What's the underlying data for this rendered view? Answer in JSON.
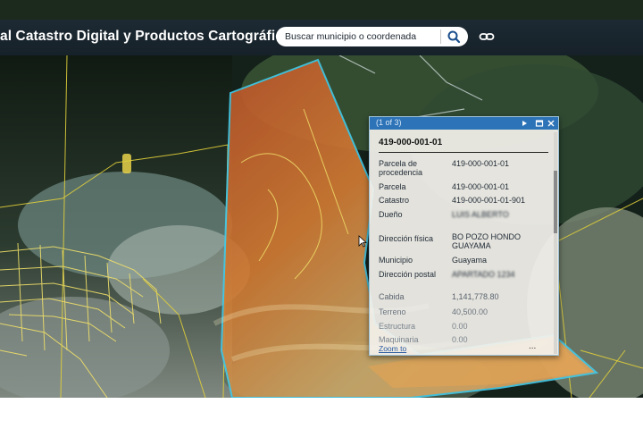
{
  "header": {
    "title": "al Catastro Digital y Productos Cartográficos",
    "search_placeholder": "Buscar municipio o coordenada"
  },
  "icons": {
    "search": "search-icon",
    "link": "link-icon",
    "next": "next-arrow-icon",
    "maximize": "maximize-icon",
    "close": "close-icon",
    "cursor": "mouse-cursor-icon"
  },
  "popup": {
    "counter": "(1 of 3)",
    "heading": "419-000-001-01",
    "fields": [
      {
        "label": "Parcela de",
        "label2": "procedencia",
        "value": "419-000-001-01"
      },
      {
        "label": "Parcela",
        "value": "419-000-001-01"
      },
      {
        "label": "Catastro",
        "value": "419-000-001-01-901"
      },
      {
        "label": "Dueño",
        "value": "LUIS ALBERTO"
      },
      {
        "label": "Dirección física",
        "value": "BO POZO HONDO",
        "value2": "GUAYAMA"
      },
      {
        "label": "Municipio",
        "value": "Guayama"
      },
      {
        "label": "Dirección postal",
        "value": "APARTADO 1234"
      },
      {
        "label": "Cabida",
        "value": "1,141,778.80"
      },
      {
        "label": "Terreno",
        "value": "40,500.00"
      },
      {
        "label": "Estructura",
        "value": "0.00"
      },
      {
        "label": "Maquinaria",
        "value": "0.00"
      }
    ],
    "zoom_link": "Zoom to",
    "more": "..."
  },
  "colors": {
    "header_bg": "#1d2a33",
    "popup_titlebar": "#2d73b7",
    "parcel_outline": "#43c8e6",
    "parcel_fill": "#d8762a",
    "parcel_lines": "#e4d23a"
  }
}
